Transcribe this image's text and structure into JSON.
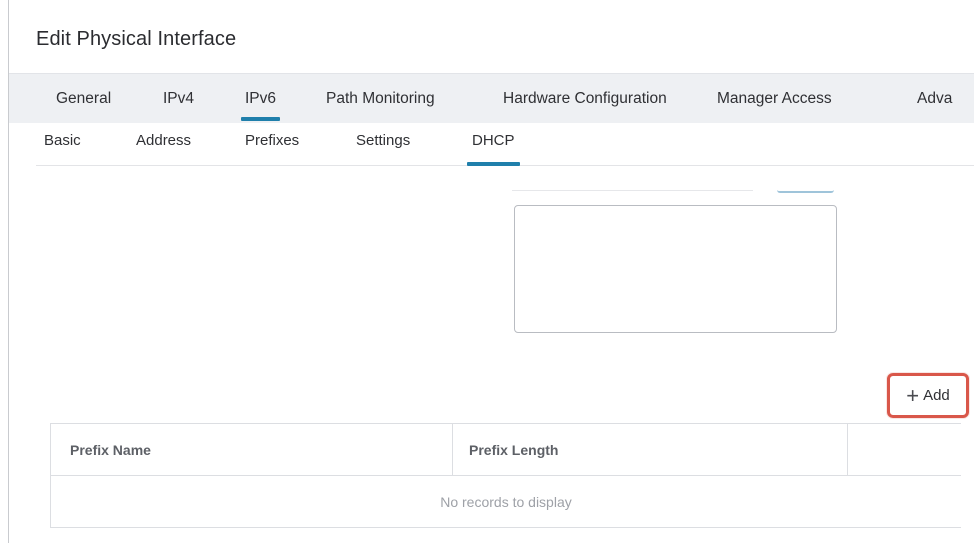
{
  "dialog": {
    "title": "Edit Physical Interface"
  },
  "tabs": [
    {
      "label": "General"
    },
    {
      "label": "IPv4"
    },
    {
      "label": "IPv6"
    },
    {
      "label": "Path Monitoring"
    },
    {
      "label": "Hardware Configuration"
    },
    {
      "label": "Manager Access"
    },
    {
      "label": "Adva"
    }
  ],
  "active_tab": "IPv6",
  "subtabs": [
    {
      "label": "Basic"
    },
    {
      "label": "Address"
    },
    {
      "label": "Prefixes"
    },
    {
      "label": "Settings"
    },
    {
      "label": "DHCP"
    }
  ],
  "active_subtab": "DHCP",
  "add_button": {
    "icon": "plus-icon",
    "label": "Add"
  },
  "table": {
    "columns": [
      "Prefix Name",
      "Prefix Length",
      ""
    ],
    "empty_message": "No records to display"
  },
  "colors": {
    "accent": "#1f7fab",
    "highlight": "#d9574a"
  }
}
